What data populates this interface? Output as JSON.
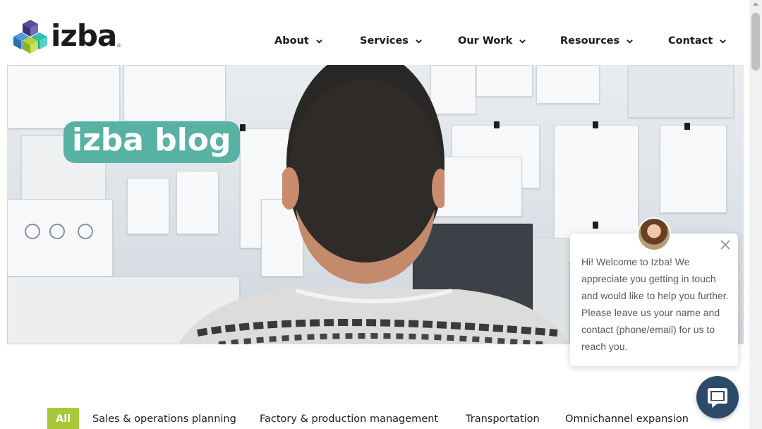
{
  "brand": {
    "name": "izba",
    "registered": "®"
  },
  "nav": {
    "items": [
      {
        "label": "About",
        "icon": "chevron-down-icon"
      },
      {
        "label": "Services",
        "icon": "chevron-down-icon"
      },
      {
        "label": "Our Work",
        "icon": "chevron-down-icon"
      },
      {
        "label": "Resources",
        "icon": "chevron-down-icon"
      },
      {
        "label": "Contact",
        "icon": "chevron-down-icon"
      }
    ]
  },
  "hero": {
    "title": "izba blog"
  },
  "chat": {
    "message": "Hi! Welcome to Izba! We appreciate you getting in touch and would like to help you further. Please leave us your name and contact (phone/email) for us to reach you.",
    "close_icon": "close-icon",
    "launcher_icon": "chat-icon"
  },
  "categories": {
    "items": [
      "All",
      "Sales & operations planning",
      "Factory & production management",
      "Transportation",
      "Omnichannel expansion"
    ],
    "active": "All"
  },
  "colors": {
    "accent_teal": "#58b2a4",
    "accent_green": "#a8c83a",
    "chat_launcher": "#2d4a6b",
    "text_dark": "#1b1b1b"
  }
}
